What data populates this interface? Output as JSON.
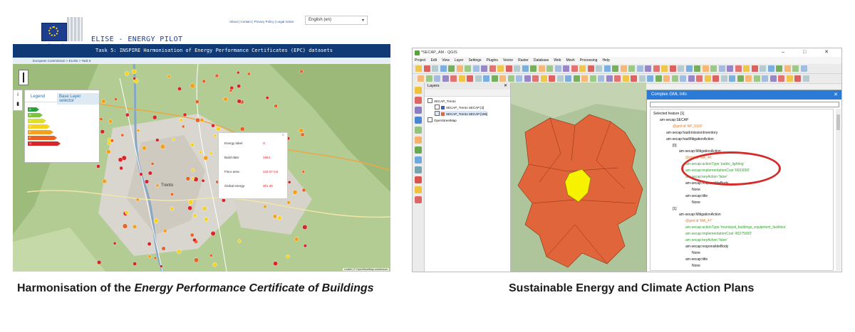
{
  "left_panel": {
    "logo_text": "European Commission",
    "top_links": "About | Contact | Privacy Policy | Legal notice",
    "language": "English (en)",
    "pilot_title": "ELISE - ENERGY PILOT",
    "task_title": "Task 5: INSPIRE Harmonisation of Energy Performance Certificates (EPC) datasets",
    "breadcrumb": "European Commission > ELISE > Task 5",
    "legend": {
      "tab_legend": "Legend",
      "tab_base": "Base Layer selector",
      "classes": [
        {
          "label": "A",
          "color": "#2aa13a"
        },
        {
          "label": "B",
          "color": "#7ec242"
        },
        {
          "label": "C",
          "color": "#d9df2c"
        },
        {
          "label": "D",
          "color": "#f7d21e"
        },
        {
          "label": "E",
          "color": "#f3a11c"
        },
        {
          "label": "F",
          "color": "#ea6122"
        },
        {
          "label": "G",
          "color": "#d8242b"
        }
      ]
    },
    "popup": {
      "close": "×",
      "rows": [
        {
          "label": "Energy label:",
          "value": "G"
        },
        {
          "label": "Build date:",
          "value": "1964"
        },
        {
          "label": "Floor area:",
          "value": "133.07 m2"
        },
        {
          "label": "Global energy:",
          "value": "301.35"
        }
      ]
    },
    "map_labels": [
      "Trento"
    ],
    "attribution": "Leaflet | © OpenStreetMap contributors"
  },
  "right_panel": {
    "window_title": "*SECAP_AM - QGIS",
    "window_controls": "–  □  ✕",
    "menus": [
      "Project",
      "Edit",
      "View",
      "Layer",
      "Settings",
      "Plugins",
      "Vector",
      "Raster",
      "Database",
      "Web",
      "Mesh",
      "Processing",
      "Help"
    ],
    "layers_panel": {
      "title": "Layers",
      "items": [
        {
          "label": "SECAP_Trento",
          "color": ""
        },
        {
          "label": "SECAP_Trento SECAP [3]",
          "color": "#3b5fc0"
        },
        {
          "label": "SECAP_Trento SECAP [186]",
          "color": "#e06a3c"
        },
        {
          "label": "OpenStreetMap",
          "color": ""
        }
      ]
    },
    "gml_info": {
      "title": "Complex GML Info",
      "rows": [
        {
          "text": "Selected feature [1]",
          "color": "black",
          "indent": 0
        },
        {
          "text": "am-secap:SECAP",
          "color": "black",
          "indent": 1
        },
        {
          "text": "@gml:id 'AP_0118'",
          "color": "orange",
          "indent": 3
        },
        {
          "text": "am-secap:hasEmissionInventory",
          "color": "black",
          "indent": 2
        },
        {
          "text": "am-secap:hasMitigationAction",
          "color": "black",
          "indent": 2
        },
        {
          "text": "[0]",
          "color": "black",
          "indent": 3
        },
        {
          "text": "am-secap:MitigationAction",
          "color": "black",
          "indent": 4
        },
        {
          "text": "@gml:id 'MA_46'",
          "color": "orange",
          "indent": 5
        },
        {
          "text": "am-secap:actionType 'public_lighting'",
          "color": "green",
          "indent": 5
        },
        {
          "text": "am-secap:implementationCost '6693000'",
          "color": "green",
          "indent": 5
        },
        {
          "text": "am-secap:keyAction 'false'",
          "color": "green",
          "indent": 5
        },
        {
          "text": "am-secap:responsibleBody",
          "color": "black",
          "indent": 5
        },
        {
          "text": "None",
          "color": "black",
          "indent": 6
        },
        {
          "text": "am-secap:title",
          "color": "black",
          "indent": 5
        },
        {
          "text": "None",
          "color": "black",
          "indent": 6
        },
        {
          "text": "[1]",
          "color": "black",
          "indent": 3
        },
        {
          "text": "am-secap:MitigationAction",
          "color": "black",
          "indent": 4
        },
        {
          "text": "@gml:id 'MA_47'",
          "color": "orange",
          "indent": 5
        },
        {
          "text": "am-secap:actionType 'municipal_buildings_equipment_facilities'",
          "color": "green",
          "indent": 5
        },
        {
          "text": "am-secap:implementationCost '45275000'",
          "color": "green",
          "indent": 5
        },
        {
          "text": "am-secap:keyAction 'false'",
          "color": "green",
          "indent": 5
        },
        {
          "text": "am-secap:responsibleBody",
          "color": "black",
          "indent": 5
        },
        {
          "text": "None",
          "color": "black",
          "indent": 6
        },
        {
          "text": "am-secap:title",
          "color": "black",
          "indent": 5
        },
        {
          "text": "None",
          "color": "black",
          "indent": 6
        }
      ]
    }
  },
  "captions": {
    "left_plain": "Harmonisation of the ",
    "left_italic": "Energy Performance Certificate of Buildings",
    "right": "Sustainable Energy and Climate Action Plans"
  }
}
